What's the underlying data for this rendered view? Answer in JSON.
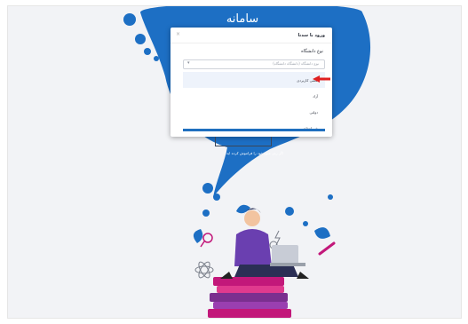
{
  "header": {
    "title": "سامانه"
  },
  "modal": {
    "title": "ورود با سدنا",
    "close_label": "×",
    "field_label": "نوع دانشگاه",
    "select_placeholder": "نوع دانشگاه (دانشگاه دانشگاه)",
    "arrow_glyph": "▾",
    "options": [
      {
        "label": "علمی کاربردی"
      },
      {
        "label": "آزاد"
      },
      {
        "label": "دولتی"
      },
      {
        "label": "غیر انتفاعی"
      }
    ]
  },
  "footer": {
    "register_link": "اگر رمز عبور خود را فراموش کرده اید؟"
  },
  "colors": {
    "accent": "#1f6fbf",
    "brand_blue": "#1d6fc4",
    "arrow": "#e02020",
    "book_magenta": "#c2187a",
    "book_purple": "#7b2f8f"
  }
}
